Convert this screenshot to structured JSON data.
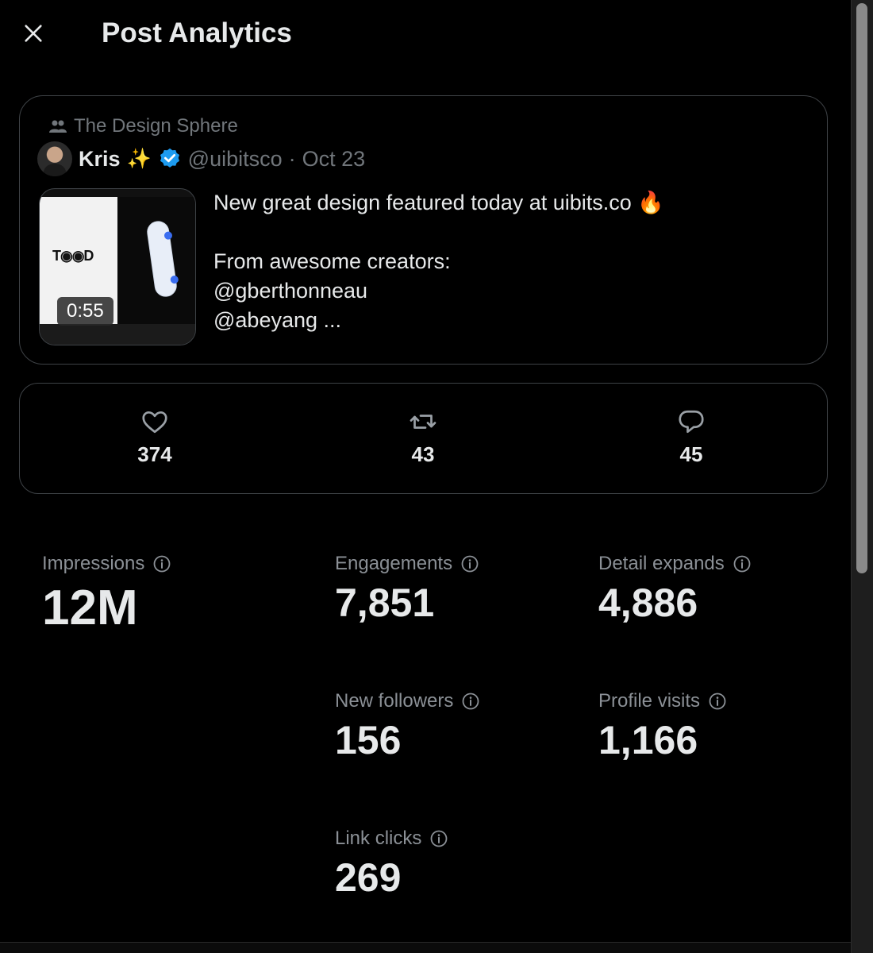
{
  "header": {
    "title": "Post Analytics",
    "close_icon": "close-icon"
  },
  "post": {
    "community": "The Design Sphere",
    "author_name": "Kris",
    "author_emoji": "✨",
    "handle": "@uibitsco",
    "separator": "·",
    "date": "Oct 23",
    "video_duration": "0:55",
    "text_line1": "New great design featured today at uibits.co 🔥",
    "text_line2": "From awesome creators:",
    "text_line3": "@gberthonneau",
    "text_line4": "@abeyang ..."
  },
  "engagement": {
    "likes": "374",
    "reposts": "43",
    "replies": "45"
  },
  "metrics": {
    "impressions_label": "Impressions",
    "impressions_value": "12M",
    "engagements_label": "Engagements",
    "engagements_value": "7,851",
    "detail_expands_label": "Detail expands",
    "detail_expands_value": "4,886",
    "new_followers_label": "New followers",
    "new_followers_value": "156",
    "profile_visits_label": "Profile visits",
    "profile_visits_value": "1,166",
    "link_clicks_label": "Link clicks",
    "link_clicks_value": "269"
  },
  "colors": {
    "background": "#000000",
    "text_primary": "#e7e9ea",
    "text_secondary": "#71767b",
    "border": "#3e4246",
    "verified_blue": "#1d9bf0"
  }
}
